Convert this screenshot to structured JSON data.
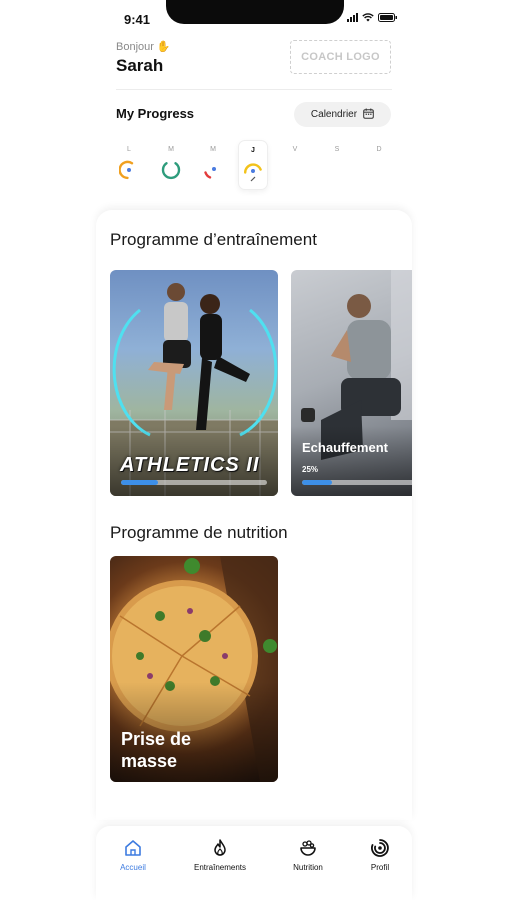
{
  "status_bar": {
    "time": "9:41"
  },
  "header": {
    "greeting": "Bonjour",
    "greeting_icon": "waving-hand-icon",
    "user_name": "Sarah",
    "coach_logo": "COACH LOGO"
  },
  "progress": {
    "title": "My Progress",
    "calendar_button": "Calendrier",
    "calendar_icon": "calendar-icon",
    "days": [
      {
        "letter": "L",
        "ring": "partial-orange",
        "active": false
      },
      {
        "letter": "M",
        "ring": "full-green",
        "active": false
      },
      {
        "letter": "M",
        "ring": "partial-red",
        "active": false
      },
      {
        "letter": "J",
        "ring": "partial-yellow",
        "active": true
      },
      {
        "letter": "V",
        "ring": "none",
        "active": false
      },
      {
        "letter": "S",
        "ring": "none",
        "active": false
      },
      {
        "letter": "D",
        "ring": "none",
        "active": false
      }
    ]
  },
  "training": {
    "title": "Programme d’entraînement",
    "programs": [
      {
        "name": "ATHLETICS II",
        "progress": 0.25
      },
      {
        "name": "Echauffement",
        "progress_label": "25%",
        "progress": 0.25
      }
    ]
  },
  "nutrition": {
    "title": "Programme de nutrition",
    "programs": [
      {
        "name": "Prise de\nmasse"
      }
    ]
  },
  "tabs": [
    {
      "label": "Accueil",
      "icon": "home-icon",
      "active": true
    },
    {
      "label": "Entraînements",
      "icon": "flame-icon",
      "active": false
    },
    {
      "label": "Nutrition",
      "icon": "food-bowl-icon",
      "active": false
    },
    {
      "label": "Profil",
      "icon": "profile-rings-icon",
      "active": false
    }
  ],
  "colors": {
    "accent": "#3d7be0",
    "progress_bar": "#3d8fe8",
    "ring_green": "#2e9c7c",
    "ring_orange": "#f0a020",
    "ring_red": "#e23c3c",
    "ring_yellow": "#f2c21a"
  }
}
